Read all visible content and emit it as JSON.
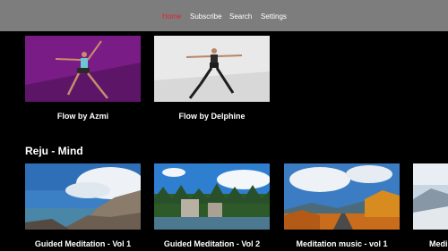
{
  "nav": {
    "items": [
      {
        "label": "Home",
        "active": true
      },
      {
        "label": "Subscribe",
        "active": false
      },
      {
        "label": "Search",
        "active": false
      },
      {
        "label": "Settings",
        "active": false
      }
    ]
  },
  "colors": {
    "topbar": "#7d7d7d",
    "active_nav": "#e0242c",
    "background": "#000000"
  },
  "row1": {
    "cards": [
      {
        "title": "Flow by Azmi",
        "thumbnail": "yoga-pose-purple-background"
      },
      {
        "title": "Flow by Delphine",
        "thumbnail": "yoga-pose-white-background"
      }
    ]
  },
  "row2": {
    "title": "Reju - Mind",
    "cards": [
      {
        "title": "Guided Meditation - Vol 1",
        "thumbnail": "rocky-coast-sky"
      },
      {
        "title": "Guided Meditation - Vol 2",
        "thumbnail": "forest-lake-cliffs"
      },
      {
        "title": "Meditation music - vol 1",
        "thumbnail": "autumn-road-clouds"
      },
      {
        "title": "Medi",
        "thumbnail": "mountain-snow-partial"
      }
    ]
  }
}
